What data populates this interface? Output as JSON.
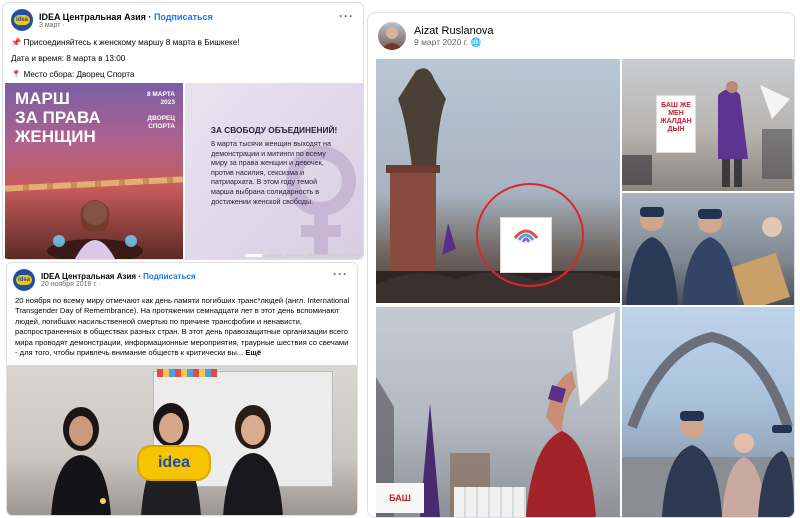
{
  "post1": {
    "page_name": "IDEA Центральная Азия",
    "separator": "·",
    "subscribe": "Подписаться",
    "date": "3 март",
    "lines": [
      "📌 Присоединяйтесь к женскому маршу 8 марта в Бишкеке!",
      "Дата и время: 8 марта в 13:00",
      "📍 Место сбора: Дворец Спорта"
    ],
    "poster_left": {
      "title_lines": [
        "МАРШ",
        "ЗА ПРАВА",
        "ЖЕНЩИН"
      ],
      "date_lines": [
        "8 МАРТА",
        "2023"
      ],
      "venue_lines": [
        "ДВОРЕЦ",
        "СПОРТА"
      ]
    },
    "poster_right": {
      "heading": "ЗА СВОБОДУ ОБЪЕДИНЕНИЙ!",
      "body": "8 марта тысячи женщин выходят на демонстрации и митинги по всему миру за права женщин и девочек, против насилия, сексизма и патриархата. В этом году темой марша выбрана солидарность в достижении женской свободы."
    }
  },
  "post2": {
    "page_name": "IDEA Центральная Азия",
    "separator": "·",
    "subscribe": "Подписаться",
    "date": "20 ноября 2016 г.",
    "text": "20 ноября по всему миру отмечают как день памяти погибших транс*людей (англ. International Transgender Day of Remembrance). На протяжении семнадцати лет в этот день вспоминают людей, погибших насильственной смертью по причине трансфобии и ненависти, распространенных в обществах разных стран. В этот день правозащитные организации всего мира проводят демонстрации, информационные мероприятия, траурные шествия со свечами - для того, чтобы привлечь внимание обществ к критически вы...",
    "more": "Ещё",
    "logo_text": "idea"
  },
  "post3": {
    "author": "Aizat Ruslanova",
    "date": "9 март 2020 г.",
    "globe": "🌐",
    "sign_main": "БАШ ЖЕ МЕН ЖАЛДАН ДЫН",
    "sign_bottom": "БАШ"
  },
  "icons": {
    "more": "more-options-icon",
    "globe": "globe-icon"
  },
  "colors": {
    "link": "#1877f2",
    "accent_red": "#e0242d",
    "idea_yellow": "#f6c400",
    "idea_blue": "#1f4fa0"
  }
}
